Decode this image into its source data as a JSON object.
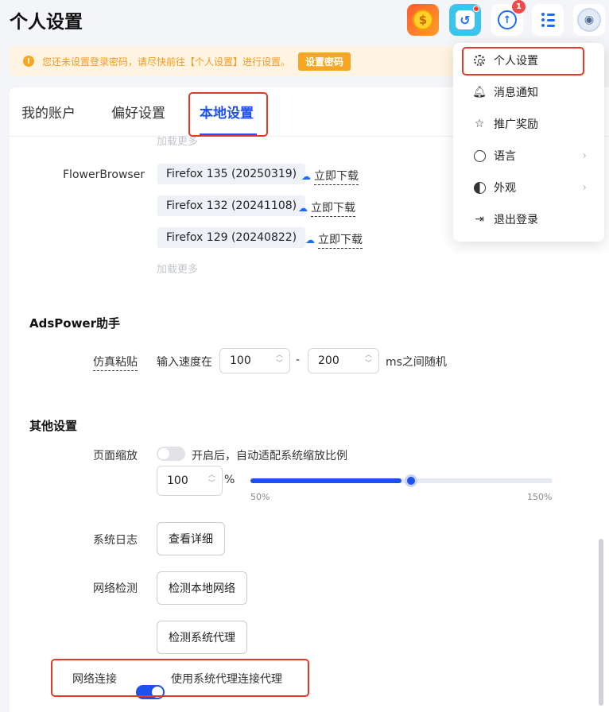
{
  "header": {
    "title": "个人设置",
    "update_badge": "1",
    "icons": {
      "coin": "coin-icon",
      "sync": "sync-icon",
      "update": "update-icon",
      "tasks": "task-list-icon",
      "avatar": "avatar-icon"
    }
  },
  "notice": {
    "text": "您还未设置登录密码，请尽快前往【个人设置】进行设置。",
    "button": "设置密码"
  },
  "tabs": [
    {
      "label": "我的账户",
      "active": false
    },
    {
      "label": "偏好设置",
      "active": false
    },
    {
      "label": "本地设置",
      "active": true
    }
  ],
  "kernel": {
    "partial_label": "加载更多",
    "browser_label": "FlowerBrowser",
    "versions": [
      {
        "name": "Firefox 135 (20250319)",
        "action": "立即下载"
      },
      {
        "name": "Firefox 132 (20241108)",
        "action": "立即下载"
      },
      {
        "name": "Firefox 129 (20240822)",
        "action": "立即下载"
      }
    ],
    "load_more": "加载更多"
  },
  "assistant": {
    "title": "AdsPower助手",
    "paste_label": "仿真粘贴",
    "speed_prefix": "输入速度在",
    "min": "100",
    "dash": "-",
    "max": "200",
    "speed_suffix": "ms之间随机"
  },
  "other": {
    "title": "其他设置",
    "zoom_label": "页面缩放",
    "zoom_toggle_text": "开启后，自动适配系统缩放比例",
    "zoom_auto": false,
    "zoom_value": "100",
    "zoom_unit": "%",
    "slider_min_label": "50%",
    "slider_max_label": "150%",
    "slider_value": 100,
    "log_label": "系统日志",
    "log_button": "查看详细",
    "net_label": "网络检测",
    "net_local_button": "检测本地网络",
    "net_proxy_button": "检测系统代理",
    "conn_label": "网络连接",
    "conn_toggle_text": "使用系统代理连接代理",
    "conn_enabled": true
  },
  "menu": {
    "items": [
      {
        "label": "个人设置",
        "icon": "gear-icon"
      },
      {
        "label": "消息通知",
        "icon": "bell-icon"
      },
      {
        "label": "推广奖励",
        "icon": "star-icon"
      },
      {
        "label": "语言",
        "icon": "globe-icon",
        "has_submenu": true
      },
      {
        "label": "外观",
        "icon": "appearance-icon",
        "has_submenu": true
      },
      {
        "label": "退出登录",
        "icon": "logout-icon"
      }
    ]
  },
  "colors": {
    "accent": "#1e50ee",
    "warning": "#f5a623",
    "highlight_box": "#e23a2a"
  }
}
